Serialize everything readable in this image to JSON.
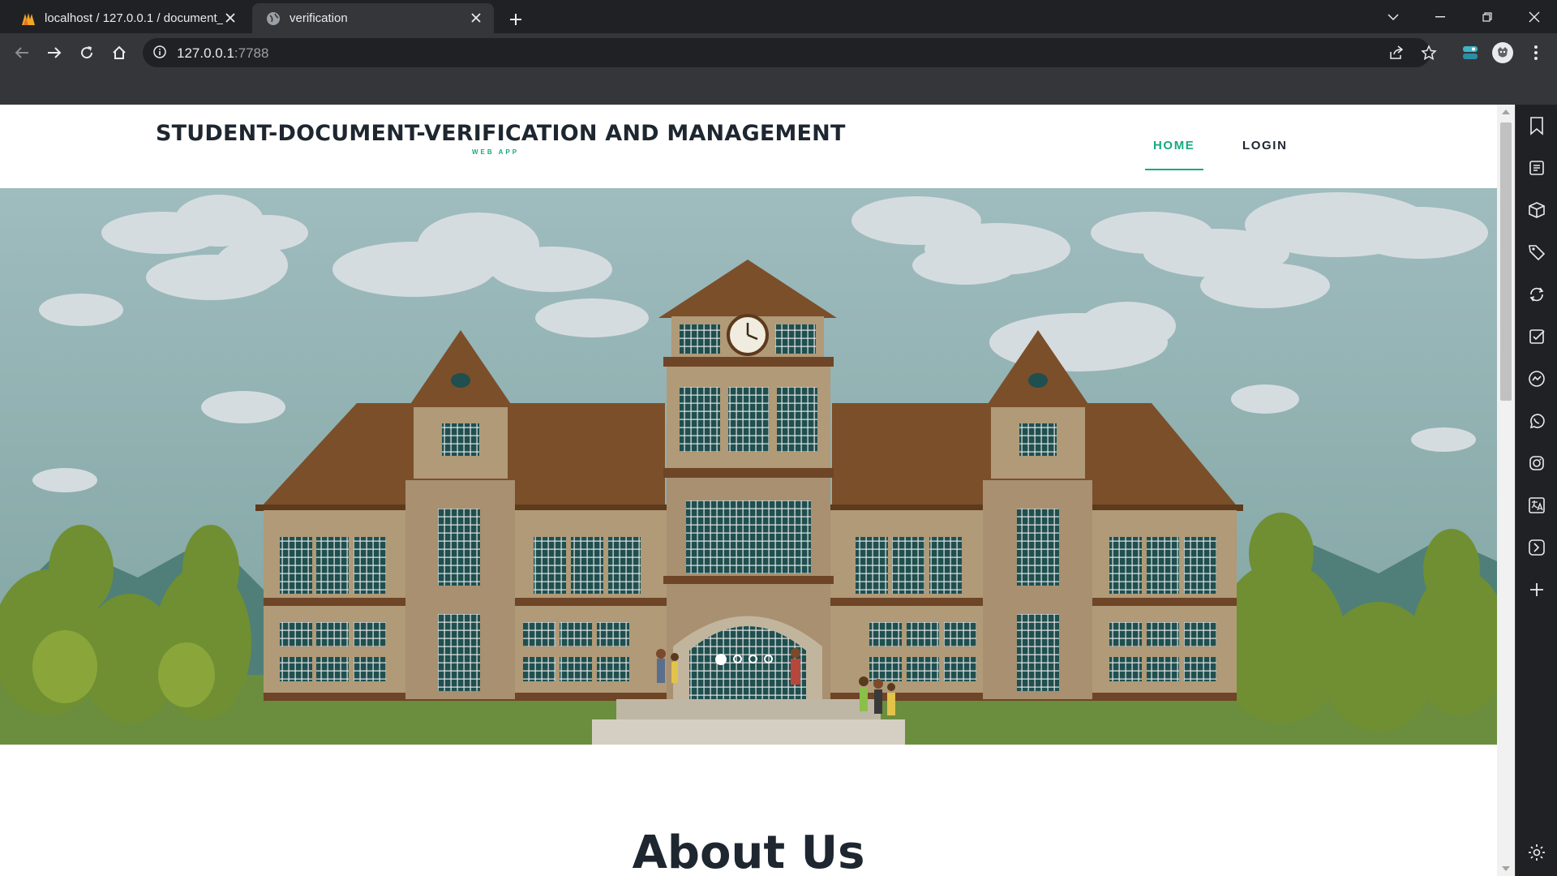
{
  "browser": {
    "tabs": [
      {
        "title": "localhost / 127.0.0.1 / document_",
        "favicon": "phpmyadmin-icon",
        "active": false
      },
      {
        "title": "verification",
        "favicon": "globe-icon",
        "active": true
      }
    ],
    "address": {
      "host": "127.0.0.1",
      "port": ":7788"
    }
  },
  "site": {
    "brand_title": "STUDENT-DOCUMENT-VERIFICATION AND MANAGEMENT",
    "brand_subtitle": "WEB APP",
    "nav": {
      "home": "HOME",
      "login": "LOGIN"
    },
    "accent_color": "#17a982",
    "carousel": {
      "slides": 4,
      "active": 1
    },
    "about_heading": "About Us"
  }
}
